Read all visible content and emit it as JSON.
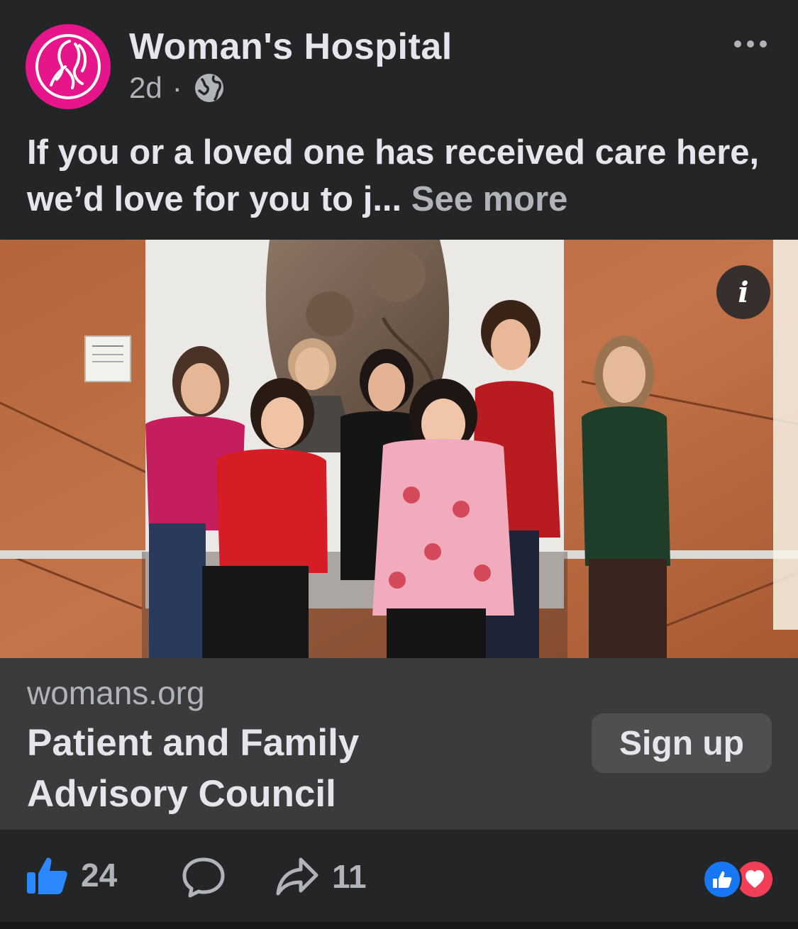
{
  "post": {
    "page_name": "Woman's Hospital",
    "time": "2d",
    "separator": "·",
    "privacy_icon": "globe-icon",
    "text": "If you or a loved one has received care here, we’d love for you to j...",
    "see_more": "See more"
  },
  "link_card": {
    "domain": "womans.org",
    "title": "Patient and Family Advisory Council",
    "cta": "Sign up"
  },
  "footer": {
    "like_count": "24",
    "share_count": "11",
    "reaction_icons": [
      "like-reaction-icon",
      "love-reaction-icon"
    ]
  },
  "colors": {
    "background": "#242526",
    "card": "#3a3b3c",
    "brand_pink": "#e6168a",
    "like_blue": "#1877f2",
    "love_red": "#f33e58"
  }
}
